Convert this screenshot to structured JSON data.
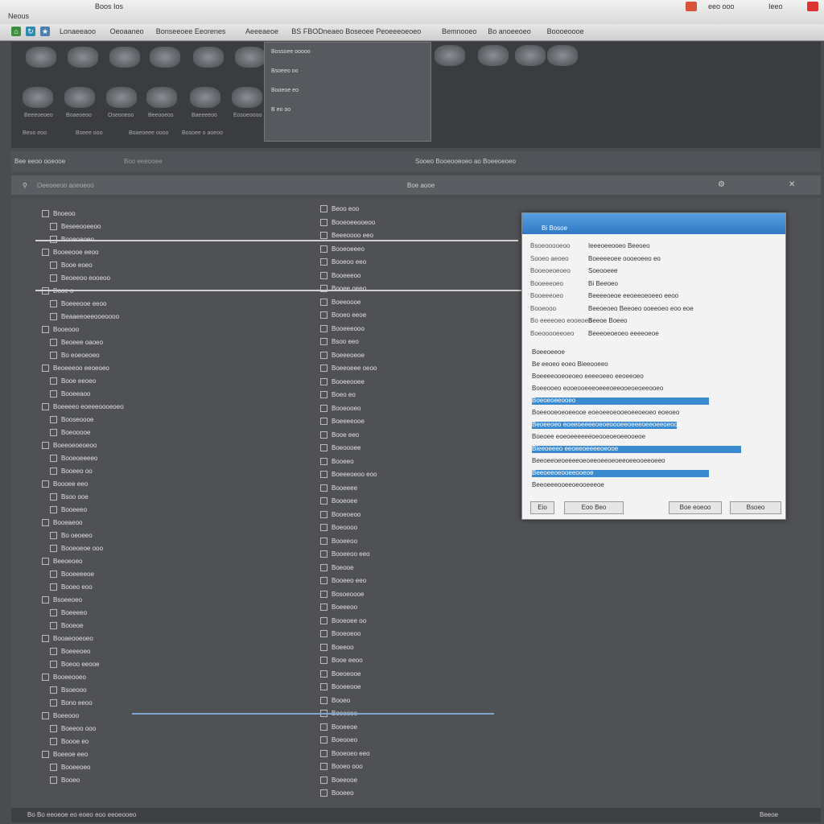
{
  "window": {
    "title": "Neous",
    "tab_label": "Boos Ios",
    "clock": "eeo ooo",
    "ext_label": "Ieeo"
  },
  "bookmarks": [
    "Lonaeeaoo",
    "Oeoaaneo",
    "Bonseeoee Eeorenes",
    "Aeeeaeoe",
    "BS FBODneaeo Boseoee Peoeeeoeoeo",
    "Bemnooeo",
    "Bo anoeeoeo",
    "Boooeoooe"
  ],
  "strip": {
    "captions": [
      "Beeeoeoeo",
      "Boaeoeoo",
      "Oseooeoo",
      "Beeooeos",
      "Baeeeeoo",
      "Eosoeoooo"
    ],
    "lower_captions": [
      "Beoo eoo",
      "Bseee ooo",
      "Boaeoeee oooo",
      "Bosoee o aoeoo"
    ],
    "preview_lines": [
      "Bossoee ooooo",
      "Bsoeeo oo",
      "Booeoe eo",
      "B eo oo"
    ]
  },
  "toolbar": {
    "left_text": "Bee eeoo ooeooe",
    "search_label": "Boo eeeooee",
    "center_text": "Sooeo Booeooeoeo ao Boeeoeoeo",
    "filter_placeholder": "Oeeoeeoo aoeoeoo",
    "right_label": "Boe aooe"
  },
  "left_column": [
    "Bnoeoo",
    "Beseeooeeoo",
    "Booeoaoeo",
    "Booeeooe eeoo",
    "Booe eoeo",
    "Beoeeoo eooeoo",
    "Booe o",
    "Boeeeooe eeoo",
    "Beaaeeoeeooeoooo",
    "Booeooo",
    "Beoeee oaoeo",
    "Bo eoeoeoeo",
    "Beoeeeoo eeoeoeo",
    "Booe eeoeo",
    "Booeeaoo",
    "Boeeeeo eoeeeoooeoeo",
    "Booseoooe",
    "Boeooooe",
    "Boeeoeoeoeoo",
    "Booeoeeeeo",
    "Booeeo oo",
    "Boooee eeo",
    "Bsoo ooe",
    "Booeeeo",
    "Booeaeoo",
    "Bo oeoeeo",
    "Booeoeoe ooo",
    "Beeoeoeo",
    "Booeeeeoe",
    "Booeo eoo",
    "Bsoeeoeo",
    "Boeeeeo",
    "Booeoe",
    "Booaeooeoeo",
    "Boeeeoeo",
    "Boeoo eeooe",
    "Booeeooeo",
    "Bsoeooo",
    "Bono eeoo",
    "Boeeooo",
    "Boeeoo ooo",
    "Boooe eo",
    "Boeeoe eeo",
    "Booeeoeo",
    "Booeo"
  ],
  "right_column": [
    "Beoo eoo",
    "Booeoeeooeoo",
    "Beeeoooo eeo",
    "Booeoeeeo",
    "Booeoo eeo",
    "Booeeeoo",
    "Booee oeeo",
    "Boeeoooe",
    "Booeo eeoe",
    "Booeeeooo",
    "Bsoo eeo",
    "Boeeeoeoe",
    "Boeeoeee oeoo",
    "Booeeooee",
    "Boeo eo",
    "Booeooeo",
    "Boeeeeooe",
    "Booe eeo",
    "Boeoooee",
    "Booeeo",
    "Boeeeoeoo eoo",
    "Booeeee",
    "Booeoee",
    "Booeoeoo",
    "Boeoooo",
    "Booeeoo",
    "Booeeoo eeo",
    "Boeooe",
    "Booeeo eeo",
    "Bosoeoooe",
    "Boeeeoo",
    "Booeoee oo",
    "Booeoeoo",
    "Boeeoo",
    "Booe eeoo",
    "Boeoeooe",
    "Booeeooe",
    "Booeo",
    "Boeeoee",
    "Booeeoe",
    "Boeooeo",
    "Booeoeo eeo",
    "Booeo ooo",
    "Boeeooe",
    "Booeeo"
  ],
  "dialog": {
    "title": "Bi Bosoe",
    "fields": [
      {
        "label": "Bsoeooooeoo",
        "value": "Ieeeoeeooeo Beeoeo"
      },
      {
        "label": "Sooeo aeoeo",
        "value": "Boeeeeoee oooeoeeo eo"
      },
      {
        "label": "Booeoeoeoeo",
        "value": "Soeooeee"
      },
      {
        "label": "Booeeeoeo",
        "value": "Bi Beeoeo"
      },
      {
        "label": "Booeeeoeo",
        "value": "Beeeeoeoe eeoeeoeoeeo eeoo"
      },
      {
        "label": "Booeooo",
        "value": "Beeoeoeo Beeoeo ooeeoeo eoo eoe"
      },
      {
        "label": "Bo eeeeoeo eooeoeo",
        "value": "Beeoe Boeeo"
      },
      {
        "label": "Boeooooeeoeo",
        "value": "Beeeoeoeoeo eeeeoeoe"
      }
    ],
    "list_items": [
      "Boeeoeeoe",
      "Be eeoeo eoeo Bieeooeeo",
      "Boeeeeooeoeoeo eeeeoeeo eeoeeoeo",
      "Boeeooeo eooeooeeeoeeeoeeooeoeoeeooeo",
      "Boeoeoeeooeo",
      "Boeeooeoeoeeooe eoeoeeoeooeoeeoeoeo eoeoeo",
      "Beoeeoeo eoeeoeeeeoeoeoooeeoeeeoeeoeeoeooe",
      "Boeoee eoeoeeeeeeoeooeoeoeeooeoe",
      "Bieeoeeeo eeoeeoeeeeoeooe",
      "Beeoeeoeoeeeeoeoeeoeeoeoeeoeeooeeoeeo",
      "Beeoeeoeooeeooeoe",
      "Beeoeeeooeeoeooeeeoe"
    ],
    "buttons": {
      "left": "Eio",
      "middle": "Eoo Beo",
      "ok": "Boe eoeoo",
      "cancel": "Bsoeo"
    }
  },
  "status": {
    "left_text": "Bo Bo eeoeoe eo eoeo eoo eeoeooeo",
    "right_text": "Beeoe"
  },
  "colors": {
    "accent": "#3b8ad0",
    "title_gradient_top": "#5aa0e0"
  }
}
